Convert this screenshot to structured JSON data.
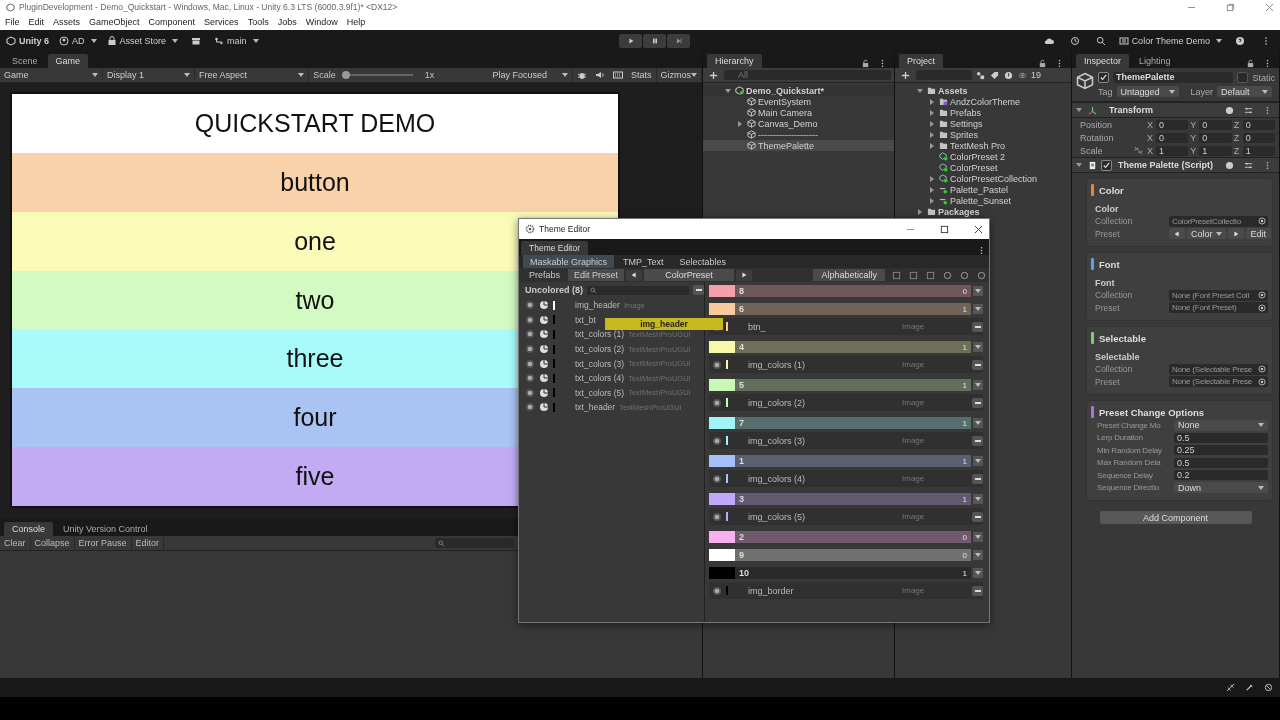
{
  "window": {
    "title": "PluginDevelopment - Demo_Quickstart - Windows, Mac, Linux - Unity 6.3 LTS (6000.3.9f1)* <DX12>",
    "menu": [
      "File",
      "Edit",
      "Assets",
      "GameObject",
      "Component",
      "Services",
      "Tools",
      "Jobs",
      "Window",
      "Help"
    ]
  },
  "toolbar": {
    "product": "Unity 6",
    "account": "AD",
    "store": "Asset Store",
    "branch": "main",
    "project": "Color Theme Demo"
  },
  "scene_tabs": [
    {
      "label": "Scene",
      "selected": false
    },
    {
      "label": "Game",
      "selected": true
    }
  ],
  "game_toolbar": {
    "mode": "Game",
    "display": "Display 1",
    "aspect": "Free Aspect",
    "scale_label": "Scale",
    "scale_slider": {
      "level": 0
    },
    "scale": "1x",
    "play_mode": "Play Focused",
    "stats": "Stats",
    "gizmos": "Gizmos"
  },
  "game_view": {
    "title": "QUICKSTART DEMO",
    "rows": [
      {
        "label": "button",
        "color": "#f9d2a9"
      },
      {
        "label": "one",
        "color": "#fafbb9"
      },
      {
        "label": "two",
        "color": "#d2fac2"
      },
      {
        "label": "three",
        "color": "#a9fafa"
      },
      {
        "label": "four",
        "color": "#a9c3f2"
      },
      {
        "label": "five",
        "color": "#c3abf4"
      }
    ]
  },
  "console": {
    "tabs": [
      {
        "label": "Console",
        "selected": true
      },
      {
        "label": "Unity Version Control",
        "selected": false
      }
    ],
    "buttons": [
      "Clear",
      "Collapse",
      "Error Pause",
      "Editor"
    ]
  },
  "hierarchy": {
    "title": "Hierarchy",
    "search_placeholder": "All",
    "tree": [
      {
        "label": "Demo_Quickstart*",
        "kind": "scene",
        "expanded": true,
        "selected": false,
        "children": [
          {
            "label": "EventSystem",
            "kind": "object",
            "selected": false
          },
          {
            "label": "Main Camera",
            "kind": "object",
            "selected": false
          },
          {
            "label": "Canvas_Demo",
            "kind": "object",
            "expanded": false,
            "selected": false
          },
          {
            "label": "--------------------",
            "kind": "object",
            "selected": false
          },
          {
            "label": "ThemePalette",
            "kind": "object",
            "selected": true
          }
        ]
      }
    ]
  },
  "project": {
    "title": "Project",
    "hidden_count": "19",
    "tree": [
      {
        "label": "Assets",
        "kind": "folder",
        "expanded": true,
        "children": [
          {
            "label": "AndzColorTheme",
            "kind": "package",
            "expanded": false
          },
          {
            "label": "Prefabs",
            "kind": "folder",
            "expanded": false
          },
          {
            "label": "Settings",
            "kind": "folder",
            "expanded": false
          },
          {
            "label": "Sprites",
            "kind": "folder",
            "expanded": false
          },
          {
            "label": "TextMesh Pro",
            "kind": "folder",
            "expanded": false
          },
          {
            "label": "ColorPreset 2",
            "kind": "asset"
          },
          {
            "label": "ColorPreset",
            "kind": "asset"
          },
          {
            "label": "ColorPresetCollection",
            "kind": "asset",
            "expanded": false
          },
          {
            "label": "Palette_Pastel",
            "kind": "palette",
            "expanded": false
          },
          {
            "label": "Palette_Sunset",
            "kind": "palette",
            "expanded": false
          }
        ]
      },
      {
        "label": "Packages",
        "kind": "folder",
        "expanded": false
      }
    ]
  },
  "inspector": {
    "tabs": [
      {
        "label": "Inspector",
        "selected": true
      },
      {
        "label": "Lighting",
        "selected": false
      }
    ],
    "object_name": "ThemePalette",
    "active": true,
    "static_label": "Static",
    "static": false,
    "tag_label": "Tag",
    "tag": "Untagged",
    "layer_label": "Layer",
    "layer": "Default",
    "transform": {
      "title": "Transform",
      "rows": [
        {
          "label": "Position",
          "values": [
            {
              "axis": "X",
              "value": "0"
            },
            {
              "axis": "Y",
              "value": "0"
            },
            {
              "axis": "Z",
              "value": "0"
            }
          ]
        },
        {
          "label": "Rotation",
          "values": [
            {
              "axis": "X",
              "value": "0"
            },
            {
              "axis": "Y",
              "value": "0"
            },
            {
              "axis": "Z",
              "value": "0"
            }
          ]
        },
        {
          "label": "Scale",
          "values": [
            {
              "axis": "X",
              "value": "1"
            },
            {
              "axis": "Y",
              "value": "1"
            },
            {
              "axis": "Z",
              "value": "1"
            }
          ]
        }
      ]
    },
    "script": {
      "title": "Theme Palette (Script)",
      "enabled": true
    },
    "sections": [
      {
        "title": "Color",
        "color": "#e0883c",
        "subtitle": "Color",
        "fields": [
          {
            "label": "Collection",
            "kind": "object",
            "value": "ColorPresetCollectio"
          },
          {
            "label": "Preset",
            "kind": "preset",
            "value": "Color",
            "action": "Edit"
          }
        ]
      },
      {
        "title": "Font",
        "color": "#5ca4e4",
        "subtitle": "Font",
        "fields": [
          {
            "label": "Collection",
            "kind": "object",
            "value": "None (Font Preset Coll"
          },
          {
            "label": "Preset",
            "kind": "object",
            "value": "None (Font Preset)"
          }
        ]
      },
      {
        "title": "Selectable",
        "color": "#7cd06c",
        "subtitle": "Selectable",
        "fields": [
          {
            "label": "Collection",
            "kind": "object",
            "value": "None (Selectable Prese"
          },
          {
            "label": "Preset",
            "kind": "object",
            "value": "None (Selectable Prese"
          }
        ]
      },
      {
        "title": "Preset Change Options",
        "color": "#b070e0",
        "fields": [
          {
            "label": "Preset Change Mo",
            "kind": "dropdown",
            "value": "None"
          },
          {
            "label": "Lerp Duration",
            "kind": "number",
            "value": "0.5"
          },
          {
            "label": "Min Random Delay",
            "kind": "number",
            "value": "0.25"
          },
          {
            "label": "Max Random Dela",
            "kind": "number",
            "value": "0.5"
          },
          {
            "label": "Sequence Delay",
            "kind": "number",
            "value": "0.2"
          },
          {
            "label": "Sequence Directio",
            "kind": "dropdown",
            "value": "Down"
          }
        ]
      }
    ],
    "add_button": "Add Component"
  },
  "theme_editor": {
    "title": "Theme Editor",
    "tab": "Theme Editor",
    "categories": [
      {
        "label": "Maskable Graphics",
        "selected": true
      },
      {
        "label": "TMP_Text",
        "selected": false
      },
      {
        "label": "Selectables",
        "selected": false
      }
    ],
    "modes": [
      {
        "label": "Prefabs",
        "selected": false
      },
      {
        "label": "Edit Preset",
        "selected": true
      }
    ],
    "preset": "ColorPreset",
    "sort": "Alphabetically",
    "uncolored_title": "Uncolored (8)",
    "uncolored": [
      {
        "name": "img_header",
        "type": "Image",
        "color": "#ffffff"
      },
      {
        "name": "txt_bt",
        "color": "#000000"
      },
      {
        "name": "txt_colors (1)",
        "type": "TextMeshProUGUI",
        "color": "#000000"
      },
      {
        "name": "txt_colors (2)",
        "type": "TextMeshProUGUI",
        "color": "#000000"
      },
      {
        "name": "txt_colors (3)",
        "type": "TextMeshProUGUI",
        "color": "#000000"
      },
      {
        "name": "txt_colors (4)",
        "type": "TextMeshProUGUI",
        "color": "#000000"
      },
      {
        "name": "txt_colors (5)",
        "type": "TextMeshProUGUI",
        "color": "#000000"
      },
      {
        "name": "txt_header",
        "type": "TextMeshProUGUI",
        "color": "#000000"
      }
    ],
    "groups": [
      {
        "label": "8",
        "color": "#f4a0a8",
        "count": "0"
      },
      {
        "label": "6",
        "color": "#f9c9a0",
        "count": "1",
        "items": [
          {
            "name": "btn_",
            "type": "Image"
          }
        ]
      },
      {
        "label": "4",
        "color": "#f8f8a8",
        "count": "1",
        "items": [
          {
            "name": "img_colors (1)",
            "type": "Image"
          }
        ]
      },
      {
        "label": "5",
        "color": "#c8f8b8",
        "count": "1",
        "items": [
          {
            "name": "img_colors (2)",
            "type": "Image"
          }
        ]
      },
      {
        "label": "7",
        "color": "#a0f4f8",
        "count": "1",
        "items": [
          {
            "name": "img_colors (3)",
            "type": "Image"
          }
        ]
      },
      {
        "label": "1",
        "color": "#a8c0f8",
        "count": "1",
        "items": [
          {
            "name": "img_colors (4)",
            "type": "Image"
          }
        ]
      },
      {
        "label": "3",
        "color": "#c0a8f8",
        "count": "1",
        "items": [
          {
            "name": "img_colors (5)",
            "type": "Image"
          }
        ]
      },
      {
        "label": "2",
        "color": "#f8b0f0",
        "count": "0"
      },
      {
        "label": "9",
        "color": "#ffffff",
        "count": "0"
      },
      {
        "label": "10",
        "color": "#000000",
        "count": "1",
        "items": [
          {
            "name": "img_border",
            "type": "Image"
          }
        ]
      }
    ],
    "drag_label": "img_header"
  }
}
